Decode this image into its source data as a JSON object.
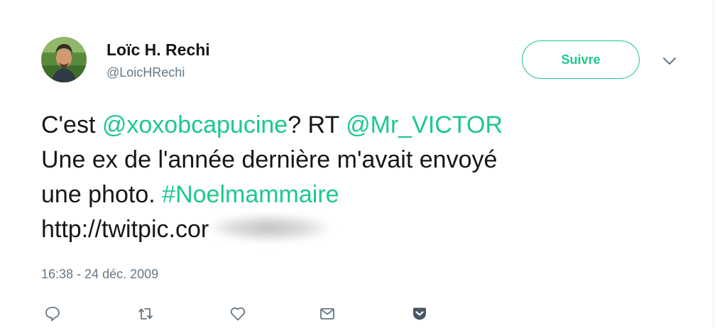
{
  "author": {
    "name": "Loïc H. Rechi",
    "handle": "@LoicHRechi"
  },
  "follow_button": {
    "label": "Suivre"
  },
  "tweet": {
    "line1": {
      "prefix": "C'est ",
      "mention1": "@xoxobcapucine",
      "middle": "? RT ",
      "mention2": "@Mr_VICTOR"
    },
    "line2": "Une ex de l'année dernière m'avait envoyé",
    "line3": {
      "prefix": "une photo. ",
      "hashtag": "#Noelmammaire"
    },
    "line4": {
      "url_visible": "http://twitpic.cor"
    },
    "timestamp": "16:38 - 24 déc. 2009"
  },
  "actions": [
    "reply-icon",
    "retweet-icon",
    "like-icon",
    "message-icon",
    "pocket-icon"
  ],
  "colors": {
    "accent": "#1dc98a",
    "text": "#14171a",
    "muted": "#657786"
  }
}
